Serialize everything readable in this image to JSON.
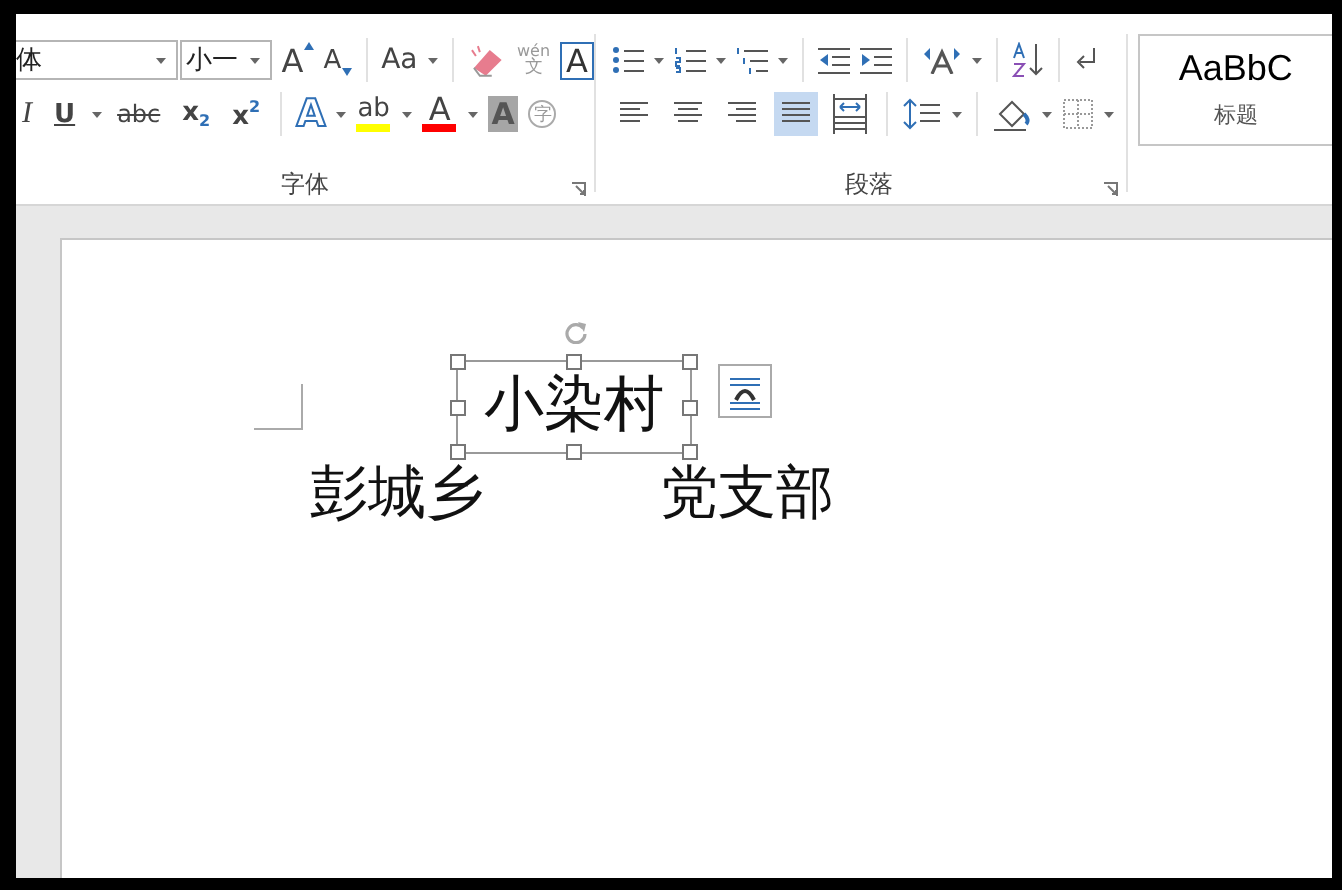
{
  "ribbon": {
    "font_group": {
      "font_name": "体",
      "font_size": "小一",
      "grow_font": "A",
      "shrink_font": "A",
      "change_case": "Aa",
      "phonetic_guide": {
        "top": "wén",
        "bottom": "文"
      },
      "char_border": "A",
      "format_buttons": [
        {
          "kind": "italic",
          "text": "I"
        },
        {
          "kind": "underline",
          "text": "U"
        },
        {
          "kind": "strike",
          "text": "abc"
        },
        {
          "kind": "script",
          "text": "x$_{2}$"
        },
        {
          "kind": "script",
          "text": "x$^{2}$"
        }
      ],
      "text_effects": [
        {
          "kind": "effect",
          "text": "A"
        },
        {
          "kind": "highlight",
          "text": "ab",
          "color": "#ffff00"
        },
        {
          "kind": "font_color",
          "text": "A",
          "color": "#ff0000"
        },
        {
          "kind": "shading",
          "text": "A"
        },
        {
          "kind": "enclose",
          "text": "字"
        }
      ],
      "label": "字体"
    },
    "paragraph_group": {
      "alignment": [
        {
          "kind": "left",
          "selected": false
        },
        {
          "kind": "center",
          "selected": false
        },
        {
          "kind": "right",
          "selected": false
        },
        {
          "kind": "justify",
          "selected": true
        },
        {
          "kind": "distributed",
          "selected": false
        }
      ],
      "label": "段落"
    },
    "styles": {
      "preview": "AaBbC",
      "name": "标题"
    }
  },
  "document": {
    "text_before": "彭城乡",
    "textbox": {
      "text": "小染村",
      "selected": true
    },
    "text_after": "党支部"
  }
}
